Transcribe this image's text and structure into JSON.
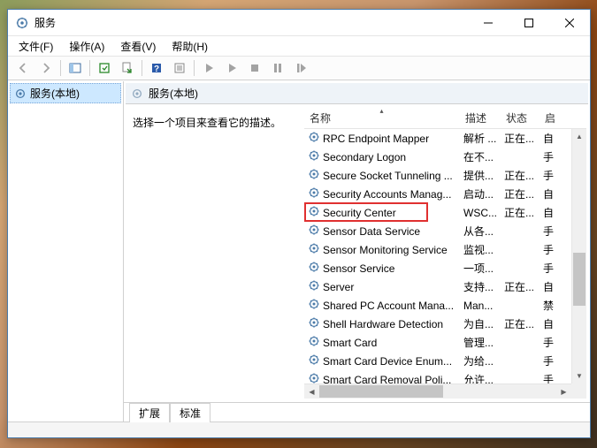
{
  "window": {
    "title": "服务"
  },
  "menu": {
    "file": "文件(F)",
    "action": "操作(A)",
    "view": "查看(V)",
    "help": "帮助(H)"
  },
  "tree": {
    "root": "服务(本地)"
  },
  "pane": {
    "header": "服务(本地)",
    "description": "选择一个项目来查看它的描述。"
  },
  "columns": {
    "name": "名称",
    "desc": "描述",
    "status": "状态",
    "startup": "启"
  },
  "services": [
    {
      "name": "RPC Endpoint Mapper",
      "desc": "解析 ...",
      "status": "正在...",
      "startup": "自"
    },
    {
      "name": "Secondary Logon",
      "desc": "在不...",
      "status": "",
      "startup": "手"
    },
    {
      "name": "Secure Socket Tunneling ...",
      "desc": "提供...",
      "status": "正在...",
      "startup": "手"
    },
    {
      "name": "Security Accounts Manag...",
      "desc": "启动...",
      "status": "正在...",
      "startup": "自"
    },
    {
      "name": "Security Center",
      "desc": "WSC...",
      "status": "正在...",
      "startup": "自",
      "highlighted": true
    },
    {
      "name": "Sensor Data Service",
      "desc": "从各...",
      "status": "",
      "startup": "手"
    },
    {
      "name": "Sensor Monitoring Service",
      "desc": "监视...",
      "status": "",
      "startup": "手"
    },
    {
      "name": "Sensor Service",
      "desc": "一项...",
      "status": "",
      "startup": "手"
    },
    {
      "name": "Server",
      "desc": "支持...",
      "status": "正在...",
      "startup": "自"
    },
    {
      "name": "Shared PC Account Mana...",
      "desc": "Man...",
      "status": "",
      "startup": "禁"
    },
    {
      "name": "Shell Hardware Detection",
      "desc": "为自...",
      "status": "正在...",
      "startup": "自"
    },
    {
      "name": "Smart Card",
      "desc": "管理...",
      "status": "",
      "startup": "手"
    },
    {
      "name": "Smart Card Device Enum...",
      "desc": "为给...",
      "status": "",
      "startup": "手"
    },
    {
      "name": "Smart Card Removal Poli...",
      "desc": "允许...",
      "status": "",
      "startup": "手"
    }
  ],
  "tabs": {
    "extended": "扩展",
    "standard": "标准"
  }
}
